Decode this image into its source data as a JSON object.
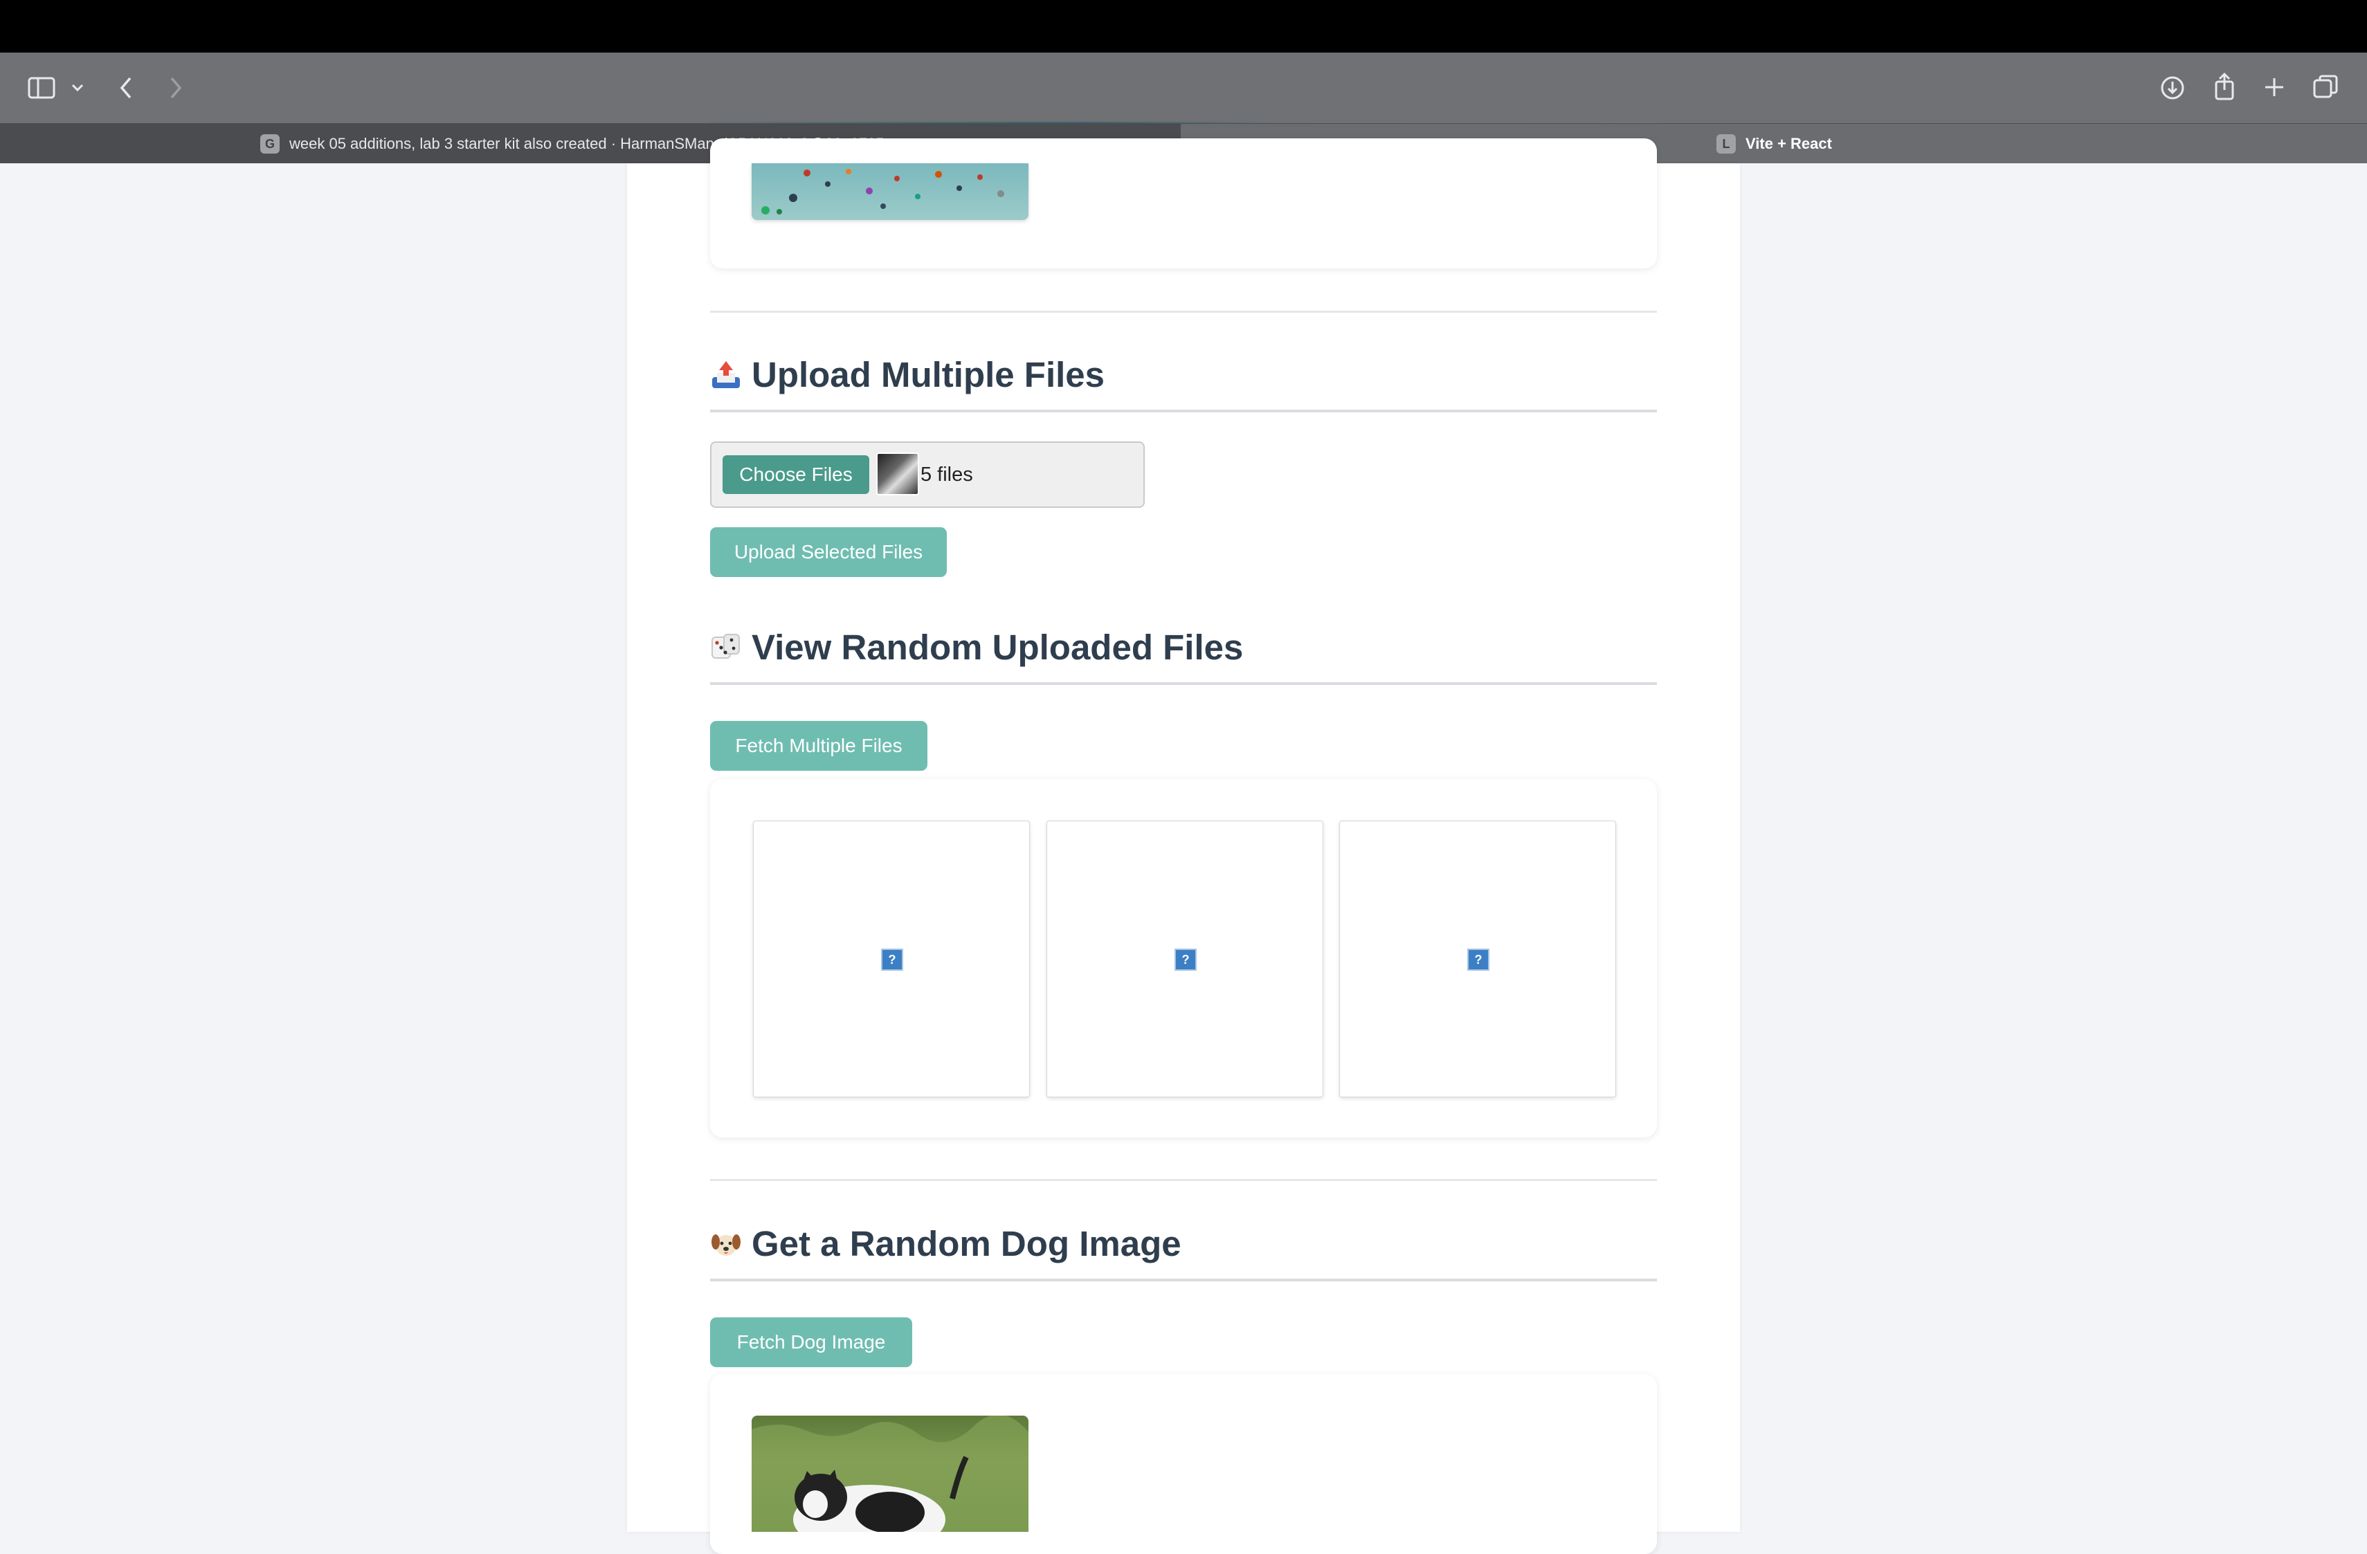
{
  "browser": {
    "url": "localhost",
    "tabs": [
      {
        "label": "week 05 additions, lab 3 starter kit also created · HarmanSMann/CPAN212-C@23a8735",
        "favicon": "G"
      },
      {
        "label": "Vite + React",
        "favicon": "L"
      }
    ],
    "icons": [
      "sidebar-icon",
      "chevron-down-icon",
      "back-icon",
      "forward-icon",
      "reader-icon",
      "reload-icon",
      "download-icon",
      "share-icon",
      "new-tab-icon",
      "tabs-overview-icon"
    ]
  },
  "upload_multiple": {
    "emoji": "outbox-tray",
    "title": "Upload Multiple Files",
    "choose_label": "Choose Files",
    "file_count": "5 files",
    "upload_button": "Upload Selected Files"
  },
  "random_uploaded": {
    "emoji": "game-die",
    "title": "View Random Uploaded Files",
    "fetch_button": "Fetch Multiple Files",
    "broken_glyph": "?"
  },
  "random_dog": {
    "emoji": "dog-face",
    "title": "Get a Random Dog Image",
    "fetch_button": "Fetch Dog Image"
  },
  "colors": {
    "accent": "#6fbdb0",
    "accent_dark": "#4a9b8c",
    "heading": "#2f3e4e"
  }
}
